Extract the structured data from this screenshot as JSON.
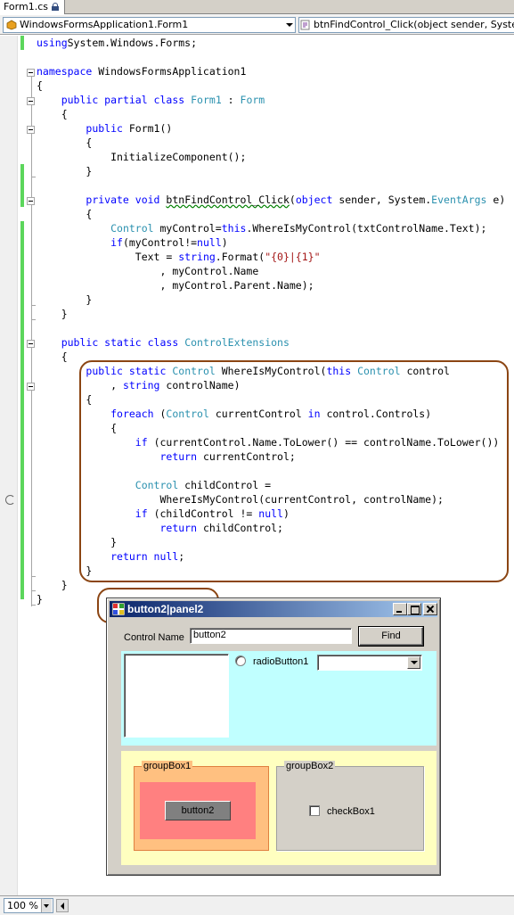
{
  "editor": {
    "tab_label": "Form1.cs",
    "class_dropdown": "WindowsFormsApplication1.Form1",
    "member_dropdown": "btnFindControl_Click(object sender, System.EventArgs e)",
    "zoom": "100 %",
    "lines": [
      {
        "tokens": [
          [
            "kw",
            "using"
          ],
          [
            "",
            "System.Windows.Forms;"
          ]
        ]
      },
      {
        "tokens": []
      },
      {
        "tokens": [
          [
            "kw",
            "namespace"
          ],
          [
            "",
            " WindowsFormsApplication1"
          ]
        ]
      },
      {
        "tokens": [
          [
            "",
            "{"
          ]
        ]
      },
      {
        "tokens": [
          [
            "",
            "    "
          ],
          [
            "kw",
            "public partial class"
          ],
          [
            "",
            " "
          ],
          [
            "ty",
            "Form1"
          ],
          [
            "",
            " : "
          ],
          [
            "ty",
            "Form"
          ]
        ]
      },
      {
        "tokens": [
          [
            "",
            "    {"
          ]
        ]
      },
      {
        "tokens": [
          [
            "",
            "        "
          ],
          [
            "kw",
            "public"
          ],
          [
            "",
            " Form1()"
          ]
        ]
      },
      {
        "tokens": [
          [
            "",
            "        {"
          ]
        ]
      },
      {
        "tokens": [
          [
            "",
            "            InitializeComponent();"
          ]
        ]
      },
      {
        "tokens": [
          [
            "",
            "        }"
          ]
        ]
      },
      {
        "tokens": []
      },
      {
        "tokens": [
          [
            "",
            "        "
          ],
          [
            "kw",
            "private void"
          ],
          [
            "",
            " "
          ],
          [
            "sq",
            "btnFindControl_Click"
          ],
          [
            "",
            "("
          ],
          [
            "kw",
            "object"
          ],
          [
            "",
            " sender, System."
          ],
          [
            "ty",
            "EventArgs"
          ],
          [
            "",
            " e)"
          ]
        ]
      },
      {
        "tokens": [
          [
            "",
            "        {"
          ]
        ]
      },
      {
        "tokens": [
          [
            "",
            "            "
          ],
          [
            "ty",
            "Control"
          ],
          [
            "",
            " myControl="
          ],
          [
            "kw",
            "this"
          ],
          [
            "",
            ".WhereIsMyControl(txtControlName.Text);"
          ]
        ]
      },
      {
        "tokens": [
          [
            "",
            "            "
          ],
          [
            "kw",
            "if"
          ],
          [
            "",
            "(myControl!="
          ],
          [
            "kw",
            "null"
          ],
          [
            "",
            ")"
          ]
        ]
      },
      {
        "tokens": [
          [
            "",
            "                Text = "
          ],
          [
            "kw",
            "string"
          ],
          [
            "",
            ".Format("
          ],
          [
            "st",
            "\"{0}|{1}\""
          ]
        ]
      },
      {
        "tokens": [
          [
            "",
            "                    , myControl.Name"
          ]
        ]
      },
      {
        "tokens": [
          [
            "",
            "                    , myControl.Parent.Name);"
          ]
        ]
      },
      {
        "tokens": [
          [
            "",
            "        }"
          ]
        ]
      },
      {
        "tokens": [
          [
            "",
            "    }"
          ]
        ]
      },
      {
        "tokens": []
      },
      {
        "tokens": [
          [
            "",
            "    "
          ],
          [
            "kw",
            "public static class"
          ],
          [
            "",
            " "
          ],
          [
            "ty",
            "ControlExtensions"
          ]
        ]
      },
      {
        "tokens": [
          [
            "",
            "    {"
          ]
        ]
      },
      {
        "tokens": [
          [
            "",
            "        "
          ],
          [
            "kw",
            "public static"
          ],
          [
            "",
            " "
          ],
          [
            "ty",
            "Control"
          ],
          [
            "",
            " WhereIsMyControl("
          ],
          [
            "kw",
            "this"
          ],
          [
            "",
            " "
          ],
          [
            "ty",
            "Control"
          ],
          [
            "",
            " control"
          ]
        ]
      },
      {
        "tokens": [
          [
            "",
            "            , "
          ],
          [
            "kw",
            "string"
          ],
          [
            "",
            " controlName)"
          ]
        ]
      },
      {
        "tokens": [
          [
            "",
            "        {"
          ]
        ]
      },
      {
        "tokens": [
          [
            "",
            "            "
          ],
          [
            "kw",
            "foreach"
          ],
          [
            "",
            " ("
          ],
          [
            "ty",
            "Control"
          ],
          [
            "",
            " currentControl "
          ],
          [
            "kw",
            "in"
          ],
          [
            "",
            " control.Controls)"
          ]
        ]
      },
      {
        "tokens": [
          [
            "",
            "            {"
          ]
        ]
      },
      {
        "tokens": [
          [
            "",
            "                "
          ],
          [
            "kw",
            "if"
          ],
          [
            "",
            " (currentControl.Name.ToLower() == controlName.ToLower())"
          ]
        ]
      },
      {
        "tokens": [
          [
            "",
            "                    "
          ],
          [
            "kw",
            "return"
          ],
          [
            "",
            " currentControl;"
          ]
        ]
      },
      {
        "tokens": []
      },
      {
        "tokens": [
          [
            "",
            "                "
          ],
          [
            "ty",
            "Control"
          ],
          [
            "",
            " childControl ="
          ]
        ]
      },
      {
        "tokens": [
          [
            "",
            "                    WhereIsMyControl(currentControl, controlName);"
          ]
        ]
      },
      {
        "tokens": [
          [
            "",
            "                "
          ],
          [
            "kw",
            "if"
          ],
          [
            "",
            " (childControl != "
          ],
          [
            "kw",
            "null"
          ],
          [
            "",
            ")"
          ]
        ]
      },
      {
        "tokens": [
          [
            "",
            "                    "
          ],
          [
            "kw",
            "return"
          ],
          [
            "",
            " childControl;"
          ]
        ]
      },
      {
        "tokens": [
          [
            "",
            "            }"
          ]
        ]
      },
      {
        "tokens": [
          [
            "",
            "            "
          ],
          [
            "kw",
            "return null"
          ],
          [
            "",
            ";"
          ]
        ]
      },
      {
        "tokens": [
          [
            "",
            "        }"
          ]
        ]
      },
      {
        "tokens": [
          [
            "",
            "    }"
          ]
        ]
      },
      {
        "tokens": [
          [
            "",
            "}"
          ]
        ]
      }
    ]
  },
  "form": {
    "title": "button2|panel2",
    "control_name_label": "Control Name",
    "control_name_value": "button2",
    "find_button": "Find",
    "radio_label": "radioButton1",
    "combo_value": "",
    "groupbox1_title": "groupBox1",
    "groupbox2_title": "groupBox2",
    "inner_button": "button2",
    "checkbox_label": "checkBox1",
    "colors": {
      "panel1": "#c0ffff",
      "panel2": "#ffffc0",
      "groupbox1": "#ffc080",
      "inner_panel": "#ff8080",
      "annotation": "#8b4513"
    }
  }
}
